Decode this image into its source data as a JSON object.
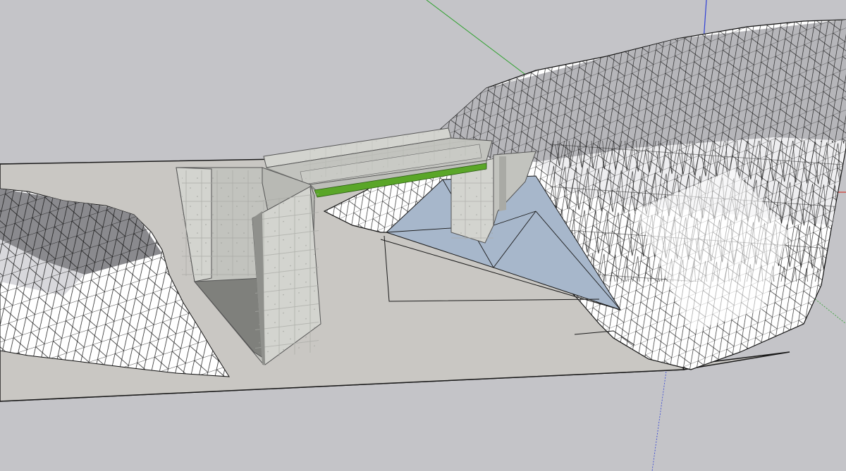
{
  "app": {
    "view": "3d-modeling-viewport"
  },
  "colors": {
    "sky": "#c4c4c8",
    "ground": "#c9c7c3",
    "ground_edge": "#1a1a1a",
    "terrain_fill": "#ffffff",
    "terrain_shade": "#d8d8dc",
    "terrain_wire": "#111111",
    "concrete_light": "#d3d4cf",
    "concrete_mid": "#c2c3be",
    "concrete_dark": "#8f908c",
    "concrete_joint": "#a9aaa5",
    "beam_green": "#5aa628",
    "glass_blue": "#a7b7cb",
    "axis_red": "#d23a2e",
    "axis_green": "#2da12d",
    "axis_blue": "#2f3fd6"
  },
  "scene": {
    "objects": [
      "ground-plane",
      "left-terrain-mesh",
      "right-terrain-mesh",
      "left-abutment",
      "right-abutment",
      "bridge-deck",
      "green-girder",
      "blue-retaining-surface"
    ],
    "axes": [
      "red-axis",
      "green-axis",
      "blue-axis"
    ]
  }
}
